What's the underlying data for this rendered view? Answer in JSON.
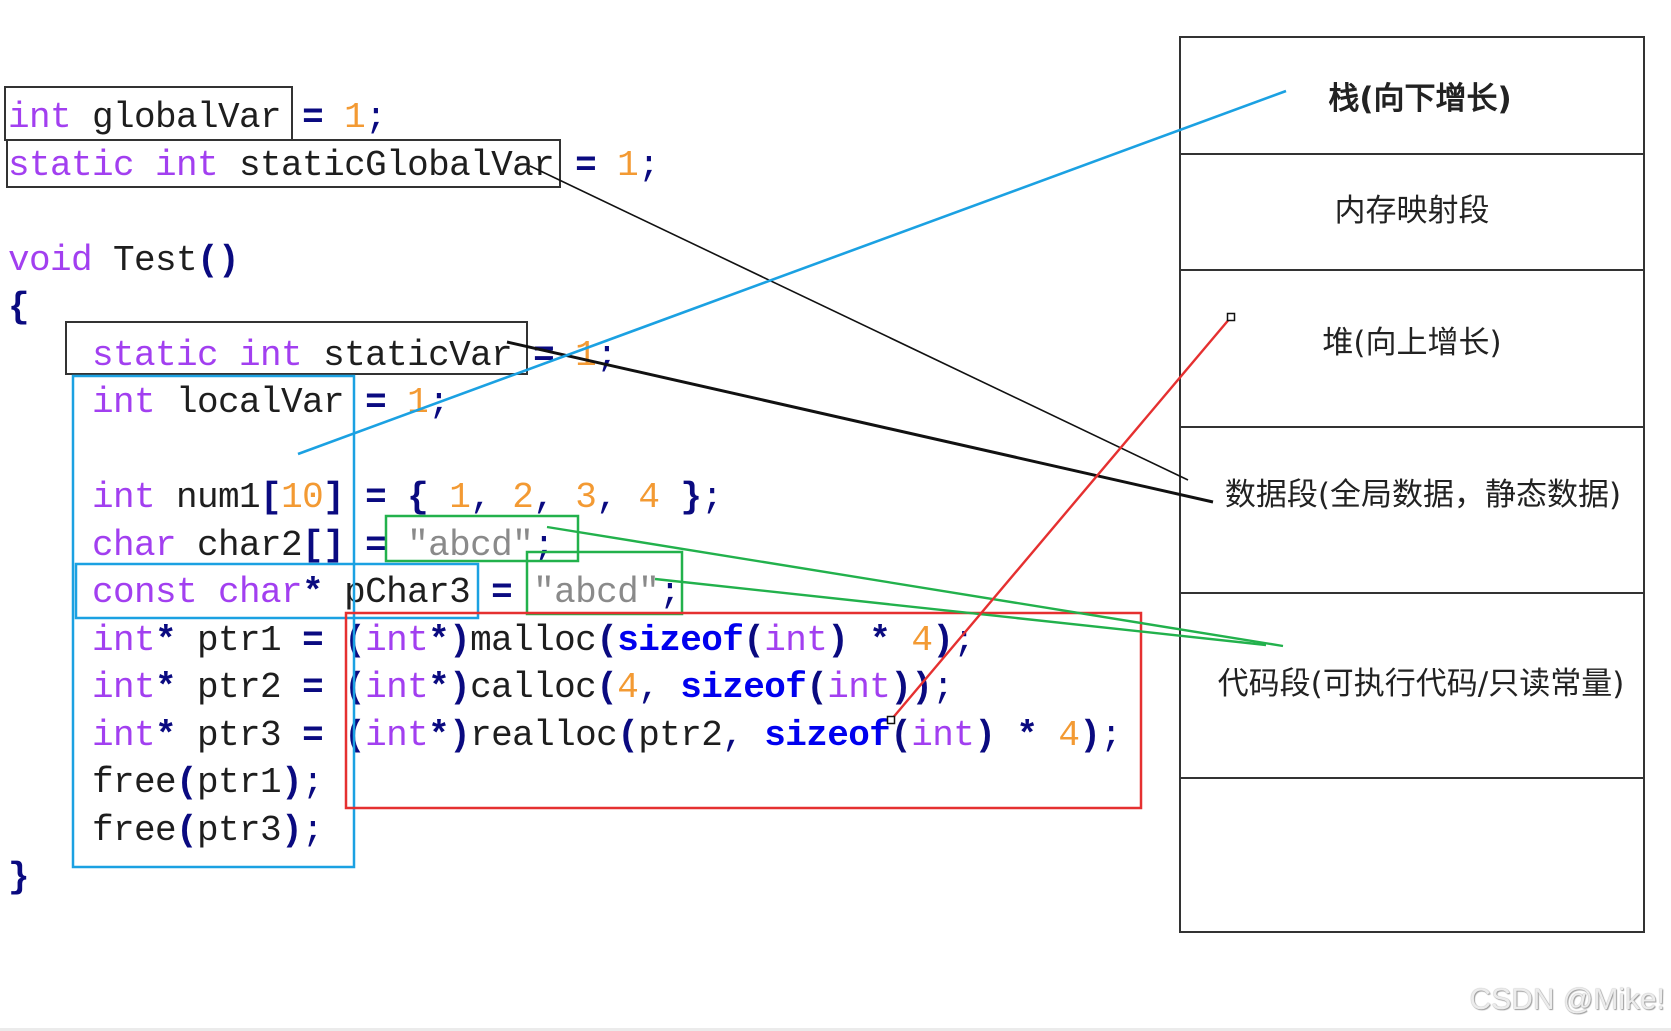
{
  "code": {
    "lines": [
      {
        "tokens": [
          {
            "t": "int",
            "k": "kw"
          },
          {
            "t": " globalVar ",
            "k": "id"
          },
          {
            "t": "=",
            "k": "op"
          },
          {
            "t": " ",
            "k": "id"
          },
          {
            "t": "1",
            "k": "num"
          },
          {
            "t": ";",
            "k": "pn"
          }
        ]
      },
      {
        "tokens": [
          {
            "t": "static int",
            "k": "kw"
          },
          {
            "t": " staticGlobalVar ",
            "k": "id"
          },
          {
            "t": "=",
            "k": "op"
          },
          {
            "t": " ",
            "k": "id"
          },
          {
            "t": "1",
            "k": "num"
          },
          {
            "t": ";",
            "k": "pn"
          }
        ]
      },
      {
        "tokens": []
      },
      {
        "tokens": [
          {
            "t": "void",
            "k": "kw"
          },
          {
            "t": " Test",
            "k": "id"
          },
          {
            "t": "()",
            "k": "op"
          }
        ]
      },
      {
        "tokens": [
          {
            "t": "{",
            "k": "op"
          }
        ]
      },
      {
        "tokens": [
          {
            "t": "    ",
            "k": "id"
          },
          {
            "t": "static int",
            "k": "kw"
          },
          {
            "t": " staticVar ",
            "k": "id"
          },
          {
            "t": "=",
            "k": "op"
          },
          {
            "t": " ",
            "k": "id"
          },
          {
            "t": "1",
            "k": "num"
          },
          {
            "t": ";",
            "k": "pn"
          }
        ]
      },
      {
        "tokens": [
          {
            "t": "    ",
            "k": "id"
          },
          {
            "t": "int",
            "k": "kw"
          },
          {
            "t": " localVar ",
            "k": "id"
          },
          {
            "t": "=",
            "k": "op"
          },
          {
            "t": " ",
            "k": "id"
          },
          {
            "t": "1",
            "k": "num"
          },
          {
            "t": ";",
            "k": "pn"
          }
        ]
      },
      {
        "tokens": []
      },
      {
        "tokens": [
          {
            "t": "    ",
            "k": "id"
          },
          {
            "t": "int",
            "k": "kw"
          },
          {
            "t": " num1",
            "k": "id"
          },
          {
            "t": "[",
            "k": "op"
          },
          {
            "t": "10",
            "k": "num"
          },
          {
            "t": "]",
            "k": "op"
          },
          {
            "t": " ",
            "k": "id"
          },
          {
            "t": "=",
            "k": "op"
          },
          {
            "t": " ",
            "k": "id"
          },
          {
            "t": "{",
            "k": "op"
          },
          {
            "t": " ",
            "k": "id"
          },
          {
            "t": "1",
            "k": "num"
          },
          {
            "t": ",",
            "k": "pn"
          },
          {
            "t": " ",
            "k": "id"
          },
          {
            "t": "2",
            "k": "num"
          },
          {
            "t": ",",
            "k": "pn"
          },
          {
            "t": " ",
            "k": "id"
          },
          {
            "t": "3",
            "k": "num"
          },
          {
            "t": ",",
            "k": "pn"
          },
          {
            "t": " ",
            "k": "id"
          },
          {
            "t": "4",
            "k": "num"
          },
          {
            "t": " ",
            "k": "id"
          },
          {
            "t": "}",
            "k": "op"
          },
          {
            "t": ";",
            "k": "pn"
          }
        ]
      },
      {
        "tokens": [
          {
            "t": "    ",
            "k": "id"
          },
          {
            "t": "char",
            "k": "kw"
          },
          {
            "t": " char2",
            "k": "id"
          },
          {
            "t": "[]",
            "k": "op"
          },
          {
            "t": " ",
            "k": "id"
          },
          {
            "t": "=",
            "k": "op"
          },
          {
            "t": " ",
            "k": "id"
          },
          {
            "t": "\"abcd\"",
            "k": "str"
          },
          {
            "t": ";",
            "k": "pn"
          }
        ]
      },
      {
        "tokens": [
          {
            "t": "    ",
            "k": "id"
          },
          {
            "t": "const char",
            "k": "kw"
          },
          {
            "t": "*",
            "k": "op"
          },
          {
            "t": " pChar3 ",
            "k": "id"
          },
          {
            "t": "=",
            "k": "op"
          },
          {
            "t": " ",
            "k": "id"
          },
          {
            "t": "\"abcd\"",
            "k": "str"
          },
          {
            "t": ";",
            "k": "pn"
          }
        ]
      },
      {
        "tokens": [
          {
            "t": "    ",
            "k": "id"
          },
          {
            "t": "int",
            "k": "kw"
          },
          {
            "t": "*",
            "k": "op"
          },
          {
            "t": " ptr1 ",
            "k": "id"
          },
          {
            "t": "=",
            "k": "op"
          },
          {
            "t": " ",
            "k": "id"
          },
          {
            "t": "(",
            "k": "op"
          },
          {
            "t": "int",
            "k": "kw"
          },
          {
            "t": "*)",
            "k": "op"
          },
          {
            "t": "malloc",
            "k": "id"
          },
          {
            "t": "(",
            "k": "op"
          },
          {
            "t": "sizeof",
            "k": "fn"
          },
          {
            "t": "(",
            "k": "op"
          },
          {
            "t": "int",
            "k": "kw"
          },
          {
            "t": ")",
            "k": "op"
          },
          {
            "t": " ",
            "k": "id"
          },
          {
            "t": "*",
            "k": "op"
          },
          {
            "t": " ",
            "k": "id"
          },
          {
            "t": "4",
            "k": "num"
          },
          {
            "t": ")",
            "k": "op"
          },
          {
            "t": ";",
            "k": "pn"
          }
        ]
      },
      {
        "tokens": [
          {
            "t": "    ",
            "k": "id"
          },
          {
            "t": "int",
            "k": "kw"
          },
          {
            "t": "*",
            "k": "op"
          },
          {
            "t": " ptr2 ",
            "k": "id"
          },
          {
            "t": "=",
            "k": "op"
          },
          {
            "t": " ",
            "k": "id"
          },
          {
            "t": "(",
            "k": "op"
          },
          {
            "t": "int",
            "k": "kw"
          },
          {
            "t": "*)",
            "k": "op"
          },
          {
            "t": "calloc",
            "k": "id"
          },
          {
            "t": "(",
            "k": "op"
          },
          {
            "t": "4",
            "k": "num"
          },
          {
            "t": ",",
            "k": "pn"
          },
          {
            "t": " ",
            "k": "id"
          },
          {
            "t": "sizeof",
            "k": "fn"
          },
          {
            "t": "(",
            "k": "op"
          },
          {
            "t": "int",
            "k": "kw"
          },
          {
            "t": "))",
            "k": "op"
          },
          {
            "t": ";",
            "k": "pn"
          }
        ]
      },
      {
        "tokens": [
          {
            "t": "    ",
            "k": "id"
          },
          {
            "t": "int",
            "k": "kw"
          },
          {
            "t": "*",
            "k": "op"
          },
          {
            "t": " ptr3 ",
            "k": "id"
          },
          {
            "t": "=",
            "k": "op"
          },
          {
            "t": " ",
            "k": "id"
          },
          {
            "t": "(",
            "k": "op"
          },
          {
            "t": "int",
            "k": "kw"
          },
          {
            "t": "*)",
            "k": "op"
          },
          {
            "t": "realloc",
            "k": "id"
          },
          {
            "t": "(",
            "k": "op"
          },
          {
            "t": "ptr2",
            "k": "id"
          },
          {
            "t": ",",
            "k": "pn"
          },
          {
            "t": " ",
            "k": "id"
          },
          {
            "t": "sizeof",
            "k": "fn"
          },
          {
            "t": "(",
            "k": "op"
          },
          {
            "t": "int",
            "k": "kw"
          },
          {
            "t": ")",
            "k": "op"
          },
          {
            "t": " ",
            "k": "id"
          },
          {
            "t": "*",
            "k": "op"
          },
          {
            "t": " ",
            "k": "id"
          },
          {
            "t": "4",
            "k": "num"
          },
          {
            "t": ")",
            "k": "op"
          },
          {
            "t": ";",
            "k": "pn"
          }
        ]
      },
      {
        "tokens": [
          {
            "t": "    free",
            "k": "id"
          },
          {
            "t": "(",
            "k": "op"
          },
          {
            "t": "ptr1",
            "k": "id"
          },
          {
            "t": ")",
            "k": "op"
          },
          {
            "t": ";",
            "k": "pn"
          }
        ]
      },
      {
        "tokens": [
          {
            "t": "    free",
            "k": "id"
          },
          {
            "t": "(",
            "k": "op"
          },
          {
            "t": "ptr3",
            "k": "id"
          },
          {
            "t": ")",
            "k": "op"
          },
          {
            "t": ";",
            "k": "pn"
          }
        ]
      },
      {
        "tokens": [
          {
            "t": "}",
            "k": "op"
          }
        ]
      }
    ]
  },
  "memory_layout": {
    "segments": [
      {
        "label": "栈(向下增长)"
      },
      {
        "label": "内存映射段"
      },
      {
        "label": "堆(向上增长)"
      },
      {
        "label": "数据段(全局数据，静态数据)"
      },
      {
        "label": "代码段(可执行代码/只读常量)"
      },
      {
        "label": ""
      }
    ]
  },
  "links": [
    {
      "from": "staticGlobalVar",
      "to": "数据段(全局数据，静态数据)",
      "color": "black"
    },
    {
      "from": "staticVar",
      "to": "数据段(全局数据，静态数据)",
      "color": "black"
    },
    {
      "from": "localVar / num1 / char2 / pChar3 / ptr1 / ptr2 / ptr3",
      "to": "栈(向下增长)",
      "color": "blue"
    },
    {
      "from": "char2 \"abcd\"",
      "to": "代码段(可执行代码/只读常量)",
      "color": "green"
    },
    {
      "from": "pChar3 \"abcd\"",
      "to": "代码段(可执行代码/只读常量)",
      "color": "green"
    },
    {
      "from": "malloc / calloc / realloc",
      "to": "堆(向上增长)",
      "color": "red"
    }
  ],
  "colors": {
    "box_black": "#333333",
    "line_black": "#111111",
    "blue": "#1ba1e2",
    "green": "#22b14c",
    "red": "#e53030",
    "handle_fill": "#ffffff",
    "table_border": "#333333"
  },
  "watermark": "CSDN @Mike!"
}
